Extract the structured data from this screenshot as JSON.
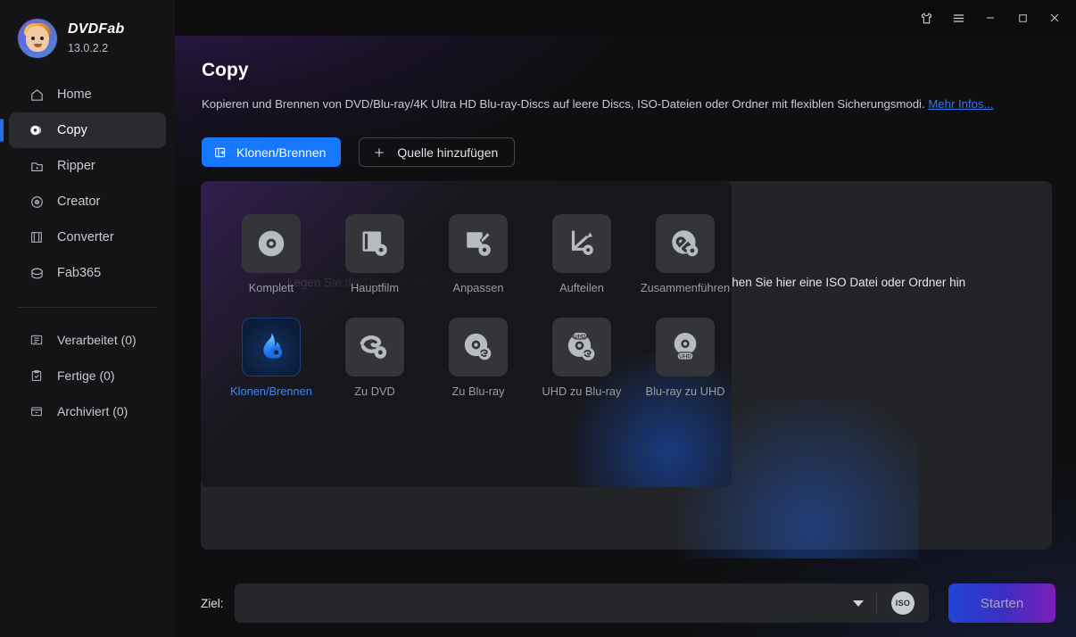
{
  "app": {
    "brand_name": "DVDFab",
    "version": "13.0.2.2",
    "logo_icon": "dvdfab-mascot-logo"
  },
  "titlebar": {
    "buttons": [
      {
        "name": "theme-button",
        "icon": "shirt-icon",
        "label": ""
      },
      {
        "name": "menu-button",
        "icon": "hamburger-icon",
        "label": ""
      },
      {
        "name": "minimize-button",
        "icon": "minimize-icon",
        "label": ""
      },
      {
        "name": "maximize-button",
        "icon": "maximize-icon",
        "label": ""
      },
      {
        "name": "close-button",
        "icon": "close-icon",
        "label": ""
      }
    ]
  },
  "sidebar": {
    "items": [
      {
        "label": "Home",
        "icon": "home-icon",
        "active": false
      },
      {
        "label": "Copy",
        "icon": "disc-copy-icon",
        "active": true
      },
      {
        "label": "Ripper",
        "icon": "ripper-icon",
        "active": false
      },
      {
        "label": "Creator",
        "icon": "disc-icon",
        "active": false
      },
      {
        "label": "Converter",
        "icon": "film-icon",
        "active": false
      },
      {
        "label": "Fab365",
        "icon": "fab365-icon",
        "active": false
      }
    ],
    "queue_items": [
      {
        "label": "Verarbeitet (0)",
        "icon": "list-icon"
      },
      {
        "label": "Fertige (0)",
        "icon": "clipboard-check-icon"
      },
      {
        "label": "Archiviert (0)",
        "icon": "archive-icon"
      }
    ]
  },
  "page": {
    "title": "Copy",
    "description": "Kopieren und Brennen von DVD/Blu-ray/4K Ultra HD Blu-ray-Discs auf leere Discs, ISO-Dateien oder Ordner mit flexiblen Sicherungsmodi.",
    "more_link": "Mehr Infos..."
  },
  "actions": {
    "mode_button_label": "Klonen/Brennen",
    "mode_button_icon": "clone-burn-icon",
    "add_source_label": "Quelle hinzufügen",
    "add_source_icon": "plus-icon"
  },
  "modes": {
    "row1": [
      {
        "label": "Komplett",
        "icon": "full-disc-icon",
        "selected": false
      },
      {
        "label": "Hauptfilm",
        "icon": "main-movie-icon",
        "selected": false
      },
      {
        "label": "Anpassen",
        "icon": "customize-icon",
        "selected": false
      },
      {
        "label": "Aufteilen",
        "icon": "split-icon",
        "selected": false
      },
      {
        "label": "Zusammenführen",
        "icon": "merge-icon",
        "selected": false
      }
    ],
    "row2": [
      {
        "label": "Klonen/Brennen",
        "icon": "flame-disc-icon",
        "selected": true
      },
      {
        "label": "Zu DVD",
        "icon": "to-dvd-icon",
        "selected": false
      },
      {
        "label": "Zu Blu-ray",
        "icon": "to-bluray-icon",
        "selected": false
      },
      {
        "label": "UHD zu Blu-ray",
        "icon": "uhd-to-bluray-icon",
        "selected": false
      },
      {
        "label": "Blu-ray zu UHD",
        "icon": "bluray-to-uhd-icon",
        "selected": false
      }
    ]
  },
  "dropzone": {
    "message": "Legen Sie die Disc ein oder klicken auf die + Taste um die Quelle zu laden Oder ziehen Sie hier eine ISO Datei oder Ordner hin"
  },
  "bottom": {
    "target_label": "Ziel:",
    "target_value": "",
    "target_placeholder": "",
    "caret_icon": "chevron-down-icon",
    "iso_badge_label": "ISO",
    "start_label": "Starten"
  },
  "colors": {
    "accent_blue": "#1677ff",
    "link_blue": "#2f7ce8",
    "selected_blue": "#3d87f0",
    "sidebar_bg": "#141416",
    "panel_bg": "#232428",
    "start_gradient_from": "#1f45d8",
    "start_gradient_to": "#7d1fb8"
  }
}
